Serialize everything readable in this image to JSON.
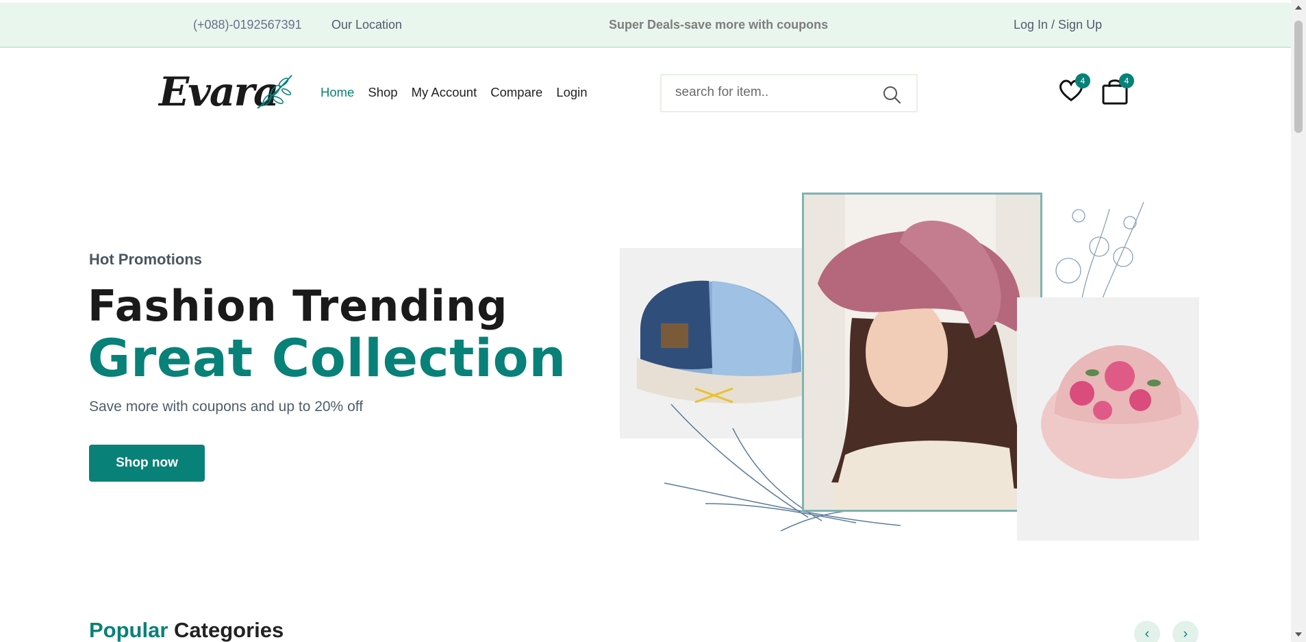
{
  "topbar": {
    "phone": "(+088)-0192567391",
    "location": "Our Location",
    "deals": "Super Deals-save more with coupons",
    "auth": "Log In / Sign Up"
  },
  "header": {
    "logo": "Evara",
    "nav": [
      "Home",
      "Shop",
      "My Account",
      "Compare",
      "Login"
    ],
    "search_placeholder": "search for item..",
    "wishlist_count": "4",
    "cart_count": "4"
  },
  "hero": {
    "subtitle": "Hot Promotions",
    "title_line1": "Fashion Trending",
    "title_line2": "Great Collection",
    "description": "Save more with coupons and up to 20% off",
    "button": "Shop now"
  },
  "categories": {
    "title_highlight": "Popular",
    "title_rest": "Categories",
    "prev_icon": "‹",
    "next_icon": "›"
  },
  "colors": {
    "accent": "#088178",
    "topbar_bg": "#e8f6ee"
  }
}
